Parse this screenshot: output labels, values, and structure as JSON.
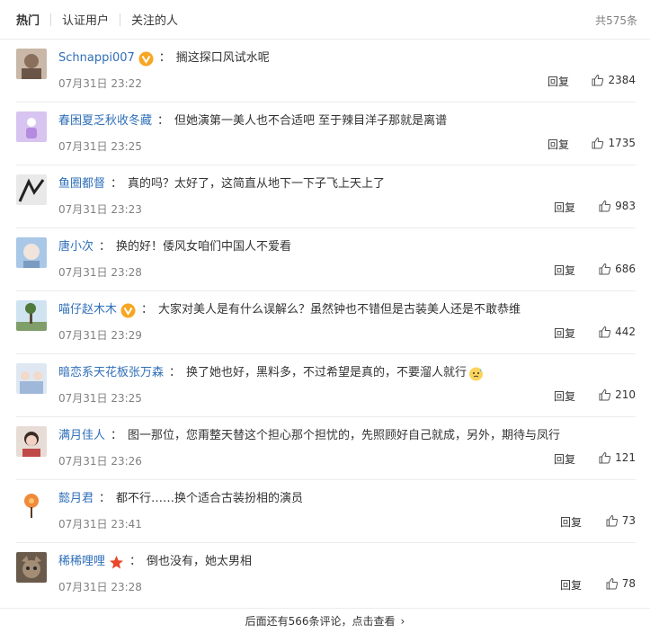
{
  "tabs": {
    "hot": "热门",
    "verified": "认证用户",
    "following": "关注的人"
  },
  "total": "共575条",
  "comments": [
    {
      "user": "Schnappi007",
      "badge": "vip",
      "text": "搁这探口风试水呢",
      "time": "07月31日 23:22",
      "reply": "回复",
      "likes": "2384",
      "avatar": "person-photo"
    },
    {
      "user": "春困夏乏秋收冬藏",
      "badge": "",
      "text": "但她演第一美人也不合适吧 至于辣目洋子那就是离谱",
      "time": "07月31日 23:25",
      "reply": "回复",
      "likes": "1735",
      "avatar": "purple-figure"
    },
    {
      "user": "鱼圈都督",
      "badge": "",
      "text": "真的吗？太好了，这简直从地下一下子飞上天上了",
      "time": "07月31日 23:23",
      "reply": "回复",
      "likes": "983",
      "avatar": "dark-sketch"
    },
    {
      "user": "唐小次",
      "badge": "",
      "text": "换的好！倭风女咱们中国人不爱看",
      "time": "07月31日 23:28",
      "reply": "回复",
      "likes": "686",
      "avatar": "blue-face"
    },
    {
      "user": "喵仔赵木木",
      "badge": "vip",
      "text": "大家对美人是有什么误解么？虽然钟也不错但是古装美人还是不敢恭维",
      "time": "07月31日 23:29",
      "reply": "回复",
      "likes": "442",
      "avatar": "landscape-tree"
    },
    {
      "user": "暗恋系天花板张万森",
      "badge": "",
      "text": "换了她也好，黑料多，不过希望是真的，不要溜人就行",
      "time": "07月31日 23:25",
      "reply": "回复",
      "likes": "210",
      "avatar": "anime-group",
      "emoji": "sweat-emoji"
    },
    {
      "user": "满月佳人",
      "badge": "",
      "text": "图一那位，您甭整天替这个担心那个担忧的，先照顾好自己就成，另外，期待与凤行",
      "time": "07月31日 23:26",
      "reply": "回复",
      "likes": "121",
      "avatar": "woman-portrait"
    },
    {
      "user": "懿月君",
      "badge": "",
      "text": "都不行……换个适合古装扮相的演员",
      "time": "07月31日 23:41",
      "reply": "回复",
      "likes": "73",
      "avatar": "orange-flower"
    },
    {
      "user": "稀稀哩哩",
      "badge": "star",
      "text": "倒也没有，她太男相",
      "time": "07月31日 23:28",
      "reply": "回复",
      "likes": "78",
      "avatar": "cat-face"
    }
  ],
  "more": "后面还有566条评论，点击查看",
  "colors": {
    "username": "#2f6fb8",
    "muted": "#808080",
    "badge": "#f6a623",
    "star": "#e8472b"
  }
}
